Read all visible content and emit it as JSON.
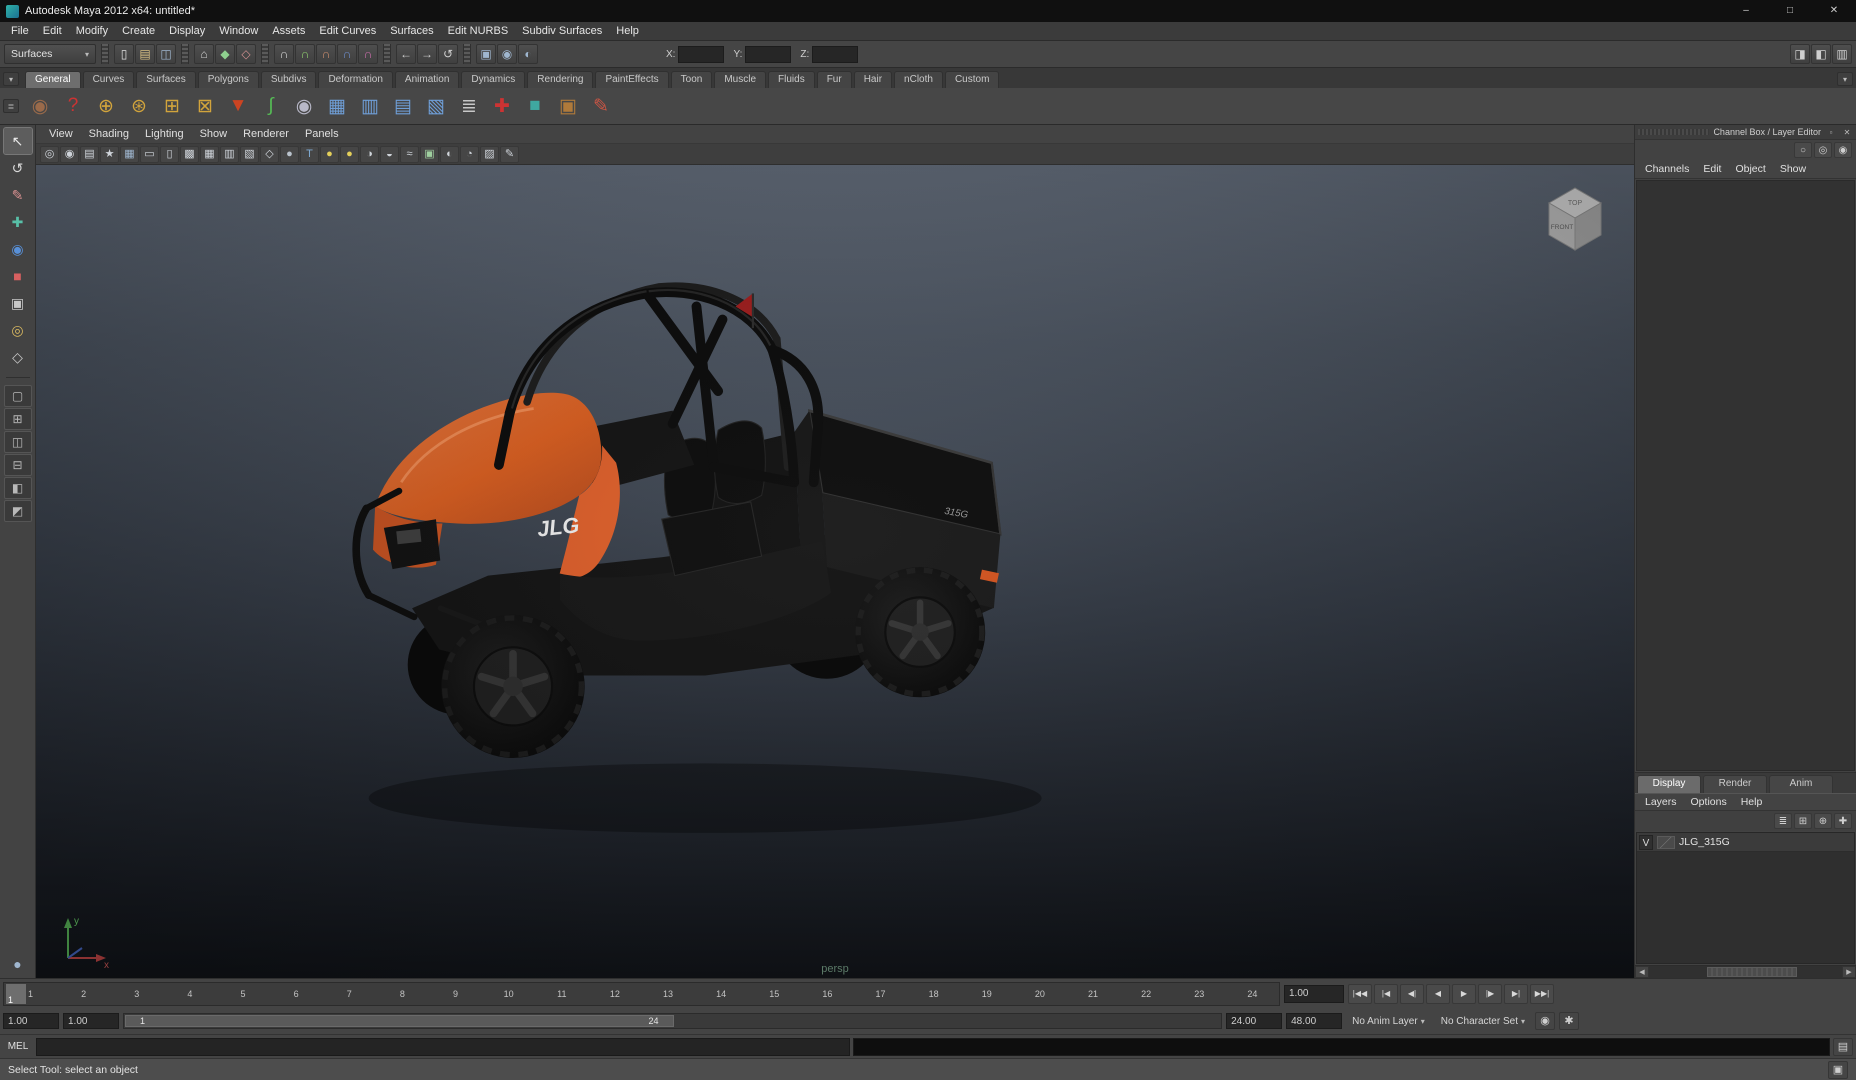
{
  "window": {
    "title": "Autodesk Maya 2012 x64: untitled*",
    "controls": [
      {
        "name": "minimize-button",
        "glyph": "–"
      },
      {
        "name": "maximize-button",
        "glyph": "□"
      },
      {
        "name": "close-button",
        "glyph": "✕"
      }
    ]
  },
  "menubar": {
    "items": [
      {
        "name": "menu-file",
        "label": "File"
      },
      {
        "name": "menu-edit",
        "label": "Edit"
      },
      {
        "name": "menu-modify",
        "label": "Modify"
      },
      {
        "name": "menu-create",
        "label": "Create"
      },
      {
        "name": "menu-display",
        "label": "Display"
      },
      {
        "name": "menu-window",
        "label": "Window"
      },
      {
        "name": "menu-assets",
        "label": "Assets"
      },
      {
        "name": "menu-edit-curves",
        "label": "Edit Curves"
      },
      {
        "name": "menu-surfaces",
        "label": "Surfaces"
      },
      {
        "name": "menu-edit-nurbs",
        "label": "Edit NURBS"
      },
      {
        "name": "menu-subdiv-surfaces",
        "label": "Subdiv Surfaces"
      },
      {
        "name": "menu-help",
        "label": "Help"
      }
    ]
  },
  "statusline": {
    "menuset": "Surfaces",
    "file_icons": [
      {
        "name": "new-scene-icon",
        "glyph": "▯",
        "color": "#e0e0e0"
      },
      {
        "name": "open-scene-icon",
        "glyph": "▤",
        "color": "#d8c084"
      },
      {
        "name": "save-scene-icon",
        "glyph": "◫",
        "color": "#9fb6cf"
      }
    ],
    "mode_icons": [
      {
        "name": "select-hierarchy-icon",
        "glyph": "⌂",
        "color": "#cfcfcf"
      },
      {
        "name": "select-object-icon",
        "glyph": "◆",
        "color": "#8fd08f"
      },
      {
        "name": "select-component-icon",
        "glyph": "◇",
        "color": "#d08f8f"
      }
    ],
    "snap_icons": [
      {
        "name": "snap-grid-icon",
        "glyph": "∩",
        "color": "#d8d8d8"
      },
      {
        "name": "snap-curve-icon",
        "glyph": "∩",
        "color": "#8fcf6f"
      },
      {
        "name": "snap-point-icon",
        "glyph": "∩",
        "color": "#cf8f6f"
      },
      {
        "name": "snap-plane-icon",
        "glyph": "∩",
        "color": "#6f8fcf"
      },
      {
        "name": "snap-surface-icon",
        "glyph": "∩",
        "color": "#cf6fae"
      }
    ],
    "history_icons": [
      {
        "name": "input-connections-icon",
        "glyph": "←",
        "color": "#cfcfcf"
      },
      {
        "name": "output-connections-icon",
        "glyph": "→",
        "color": "#cfcfcf"
      },
      {
        "name": "construction-history-icon",
        "glyph": "↺",
        "color": "#cfcfcf"
      }
    ],
    "render_icons": [
      {
        "name": "render-view-icon",
        "glyph": "▣",
        "color": "#9fb6cf"
      },
      {
        "name": "render-current-frame-icon",
        "glyph": "◉",
        "color": "#9fb6cf"
      },
      {
        "name": "ipr-render-icon",
        "glyph": "◐",
        "color": "#9fb6cf"
      }
    ],
    "x_label": "X:",
    "y_label": "Y:",
    "z_label": "Z:",
    "x_value": "",
    "y_value": "",
    "z_value": "",
    "right_toggles": [
      {
        "name": "attribute-editor-toggle",
        "glyph": "◨",
        "color": "#cfcfcf"
      },
      {
        "name": "tool-settings-toggle",
        "glyph": "◧",
        "color": "#cfcfcf"
      },
      {
        "name": "channel-box-toggle",
        "glyph": "▥",
        "color": "#cfcfcf"
      }
    ]
  },
  "shelf": {
    "tabs": [
      {
        "name": "shelf-tab-general",
        "label": "General",
        "active": true
      },
      {
        "name": "shelf-tab-curves",
        "label": "Curves"
      },
      {
        "name": "shelf-tab-surfaces",
        "label": "Surfaces"
      },
      {
        "name": "shelf-tab-polygons",
        "label": "Polygons"
      },
      {
        "name": "shelf-tab-subdivs",
        "label": "Subdivs"
      },
      {
        "name": "shelf-tab-deformation",
        "label": "Deformation"
      },
      {
        "name": "shelf-tab-animation",
        "label": "Animation"
      },
      {
        "name": "shelf-tab-dynamics",
        "label": "Dynamics"
      },
      {
        "name": "shelf-tab-rendering",
        "label": "Rendering"
      },
      {
        "name": "shelf-tab-painteffects",
        "label": "PaintEffects"
      },
      {
        "name": "shelf-tab-toon",
        "label": "Toon"
      },
      {
        "name": "shelf-tab-muscle",
        "label": "Muscle"
      },
      {
        "name": "shelf-tab-fluids",
        "label": "Fluids"
      },
      {
        "name": "shelf-tab-fur",
        "label": "Fur"
      },
      {
        "name": "shelf-tab-hair",
        "label": "Hair"
      },
      {
        "name": "shelf-tab-ncloth",
        "label": "nCloth"
      },
      {
        "name": "shelf-tab-custom",
        "label": "Custom"
      }
    ],
    "icons": [
      {
        "name": "shelf-renderglobe-icon",
        "glyph": "◉",
        "color": "#9a6a4a"
      },
      {
        "name": "shelf-help-icon",
        "glyph": "?",
        "color": "#cc3333"
      },
      {
        "name": "shelf-cluster-icon",
        "glyph": "⊕",
        "color": "#d2a43c"
      },
      {
        "name": "shelf-softmod-icon",
        "glyph": "⊛",
        "color": "#d2a43c"
      },
      {
        "name": "shelf-lattice-icon",
        "glyph": "⊞",
        "color": "#d2a43c"
      },
      {
        "name": "shelf-wrap-icon",
        "glyph": "⊠",
        "color": "#d2a43c"
      },
      {
        "name": "shelf-funnel-icon",
        "glyph": "▼",
        "color": "#cc4422"
      },
      {
        "name": "shelf-curve-icon",
        "glyph": "∫",
        "color": "#55bb55"
      },
      {
        "name": "shelf-spheres-icon",
        "glyph": "◉",
        "color": "#b8b8c8"
      },
      {
        "name": "shelf-plane-x-icon",
        "glyph": "▦",
        "color": "#6f9fd8"
      },
      {
        "name": "shelf-plane-y-icon",
        "glyph": "▥",
        "color": "#6f9fd8"
      },
      {
        "name": "shelf-plane-z-icon",
        "glyph": "▤",
        "color": "#6f9fd8"
      },
      {
        "name": "shelf-plane-free-icon",
        "glyph": "▧",
        "color": "#6f9fd8"
      },
      {
        "name": "shelf-measure-icon",
        "glyph": "≣",
        "color": "#c8c8c8"
      },
      {
        "name": "shelf-locator-icon",
        "glyph": "✚",
        "color": "#cc3333"
      },
      {
        "name": "shelf-cube-icon",
        "glyph": "■",
        "color": "#3fa8a0"
      },
      {
        "name": "shelf-crate-icon",
        "glyph": "▣",
        "color": "#b07a3a"
      },
      {
        "name": "shelf-paint-icon",
        "glyph": "✎",
        "color": "#cc5544"
      }
    ]
  },
  "toolbox": {
    "tools": [
      {
        "name": "select-tool",
        "glyph": "↖",
        "color": "#e8e8e8",
        "active": true
      },
      {
        "name": "lasso-select-tool",
        "glyph": "↺",
        "color": "#d8d8d8"
      },
      {
        "name": "paint-select-tool",
        "glyph": "✎",
        "color": "#d89090"
      },
      {
        "name": "move-tool",
        "glyph": "✚",
        "color": "#58c0a8"
      },
      {
        "name": "rotate-tool",
        "glyph": "◉",
        "color": "#5890d8"
      },
      {
        "name": "scale-tool",
        "glyph": "■",
        "color": "#d86060"
      },
      {
        "name": "universal-manipulator-tool",
        "glyph": "▣",
        "color": "#c8c8c8"
      },
      {
        "name": "soft-modification-tool",
        "glyph": "◎",
        "color": "#d8b860"
      },
      {
        "name": "last-used-tool",
        "glyph": "◇",
        "color": "#c8c8c8"
      }
    ],
    "layouts": [
      {
        "name": "layout-single-pane",
        "glyph": "▢"
      },
      {
        "name": "layout-four-pane",
        "glyph": "⊞"
      },
      {
        "name": "layout-two-pane-side",
        "glyph": "◫"
      },
      {
        "name": "layout-two-pane-stacked",
        "glyph": "⊟"
      },
      {
        "name": "layout-persp-outliner",
        "glyph": "◧"
      },
      {
        "name": "layout-hypershade-persp",
        "glyph": "◩"
      }
    ],
    "bottom_glyph": "●"
  },
  "viewport": {
    "menus": [
      {
        "name": "vp-menu-view",
        "label": "View"
      },
      {
        "name": "vp-menu-shading",
        "label": "Shading"
      },
      {
        "name": "vp-menu-lighting",
        "label": "Lighting"
      },
      {
        "name": "vp-menu-show",
        "label": "Show"
      },
      {
        "name": "vp-menu-renderer",
        "label": "Renderer"
      },
      {
        "name": "vp-menu-panels",
        "label": "Panels"
      }
    ],
    "toolbar_icons": [
      {
        "name": "select-camera-icon",
        "glyph": "◎",
        "color": "#cfd4da"
      },
      {
        "name": "lock-camera-icon",
        "glyph": "◉",
        "color": "#cfd4da"
      },
      {
        "name": "camera-attributes-icon",
        "glyph": "▤",
        "color": "#cfd4da"
      },
      {
        "name": "bookmarks-icon",
        "glyph": "★",
        "color": "#cfd4da"
      },
      {
        "name": "image-plane-icon",
        "glyph": "▦",
        "color": "#9fb6cf"
      },
      {
        "name": "film-gate-icon",
        "glyph": "▭",
        "color": "#cfd4da"
      },
      {
        "name": "resolution-gate-icon",
        "glyph": "▯",
        "color": "#cfd4da"
      },
      {
        "name": "gate-mask-icon",
        "glyph": "▩",
        "color": "#cfd4da"
      },
      {
        "name": "field-chart-icon",
        "glyph": "▦",
        "color": "#cfd4da"
      },
      {
        "name": "safe-action-icon",
        "glyph": "▥",
        "color": "#cfd4da"
      },
      {
        "name": "safe-title-icon",
        "glyph": "▧",
        "color": "#cfd4da"
      },
      {
        "name": "wireframe-icon",
        "glyph": "◇",
        "color": "#cfd4da"
      },
      {
        "name": "smooth-shade-icon",
        "glyph": "●",
        "color": "#b9c2cc"
      },
      {
        "name": "textured-icon",
        "glyph": "T",
        "color": "#7fa8d0"
      },
      {
        "name": "use-default-lighting-icon",
        "glyph": "●",
        "color": "#e3cf5a"
      },
      {
        "name": "use-all-lights-icon",
        "glyph": "●",
        "color": "#e3cf5a"
      },
      {
        "name": "shadows-icon",
        "glyph": "◑",
        "color": "#cfd4da"
      },
      {
        "name": "screen-space-ao-icon",
        "glyph": "◒",
        "color": "#cfd4da"
      },
      {
        "name": "motion-blur-icon",
        "glyph": "≈",
        "color": "#cfd4da"
      },
      {
        "name": "multisampling-icon",
        "glyph": "▣",
        "color": "#9fcf9f"
      },
      {
        "name": "depth-of-field-icon",
        "glyph": "◐",
        "color": "#cfd4da"
      },
      {
        "name": "isolate-select-icon",
        "glyph": "◔",
        "color": "#cfd4da"
      },
      {
        "name": "xray-icon",
        "glyph": "▨",
        "color": "#cfd4da"
      },
      {
        "name": "grease-pencil-icon",
        "glyph": "✎",
        "color": "#cfd4da"
      }
    ],
    "camera_label": "persp",
    "viewcube": {
      "top": "TOP",
      "front": "FRONT"
    },
    "axis": {
      "y": "y",
      "x": "x"
    },
    "model": {
      "hood_decal": "JLG",
      "bed_decal": "315G"
    }
  },
  "channelbox": {
    "header": "Channel Box / Layer Editor",
    "manip_icons": [
      {
        "name": "manip-off-icon",
        "glyph": "○"
      },
      {
        "name": "manip-hidden-icon",
        "glyph": "◎"
      },
      {
        "name": "manip-show-icon",
        "glyph": "◉"
      }
    ],
    "menus": [
      {
        "name": "cb-menu-channels",
        "label": "Channels"
      },
      {
        "name": "cb-menu-edit",
        "label": "Edit"
      },
      {
        "name": "cb-menu-object",
        "label": "Object"
      },
      {
        "name": "cb-menu-show",
        "label": "Show"
      }
    ]
  },
  "layereditor": {
    "tabs": [
      {
        "name": "le-tab-display",
        "label": "Display",
        "active": true
      },
      {
        "name": "le-tab-render",
        "label": "Render"
      },
      {
        "name": "le-tab-anim",
        "label": "Anim"
      }
    ],
    "menus": [
      {
        "name": "le-menu-layers",
        "label": "Layers"
      },
      {
        "name": "le-menu-options",
        "label": "Options"
      },
      {
        "name": "le-menu-help",
        "label": "Help"
      }
    ],
    "icons": [
      {
        "name": "layer-sort-icon",
        "glyph": "≣"
      },
      {
        "name": "new-empty-layer-icon",
        "glyph": "⊞"
      },
      {
        "name": "new-layer-assign-icon",
        "glyph": "⊕"
      },
      {
        "name": "new-layer-icon",
        "glyph": "✚"
      }
    ],
    "layers": [
      {
        "visibility": "V",
        "name": "JLG_315G"
      }
    ]
  },
  "timeslider": {
    "ticks": [
      "1",
      "2",
      "3",
      "4",
      "5",
      "6",
      "7",
      "8",
      "9",
      "10",
      "11",
      "12",
      "13",
      "14",
      "15",
      "16",
      "17",
      "18",
      "19",
      "20",
      "21",
      "22",
      "23",
      "24"
    ],
    "current_frame": "1",
    "current_time": "1.00",
    "transport": [
      {
        "name": "go-to-start-button",
        "glyph": "|◀◀"
      },
      {
        "name": "step-back-frame-button",
        "glyph": "|◀"
      },
      {
        "name": "step-back-key-button",
        "glyph": "◀|"
      },
      {
        "name": "play-backwards-button",
        "glyph": "◀"
      },
      {
        "name": "play-forwards-button",
        "glyph": "▶"
      },
      {
        "name": "step-forward-key-button",
        "glyph": "|▶"
      },
      {
        "name": "step-forward-frame-button",
        "glyph": "▶|"
      },
      {
        "name": "go-to-end-button",
        "glyph": "▶▶|"
      }
    ]
  },
  "rangeslider": {
    "anim_start": "1.00",
    "playback_start": "1.00",
    "range_start_label": "1",
    "range_end_label": "24",
    "playback_end": "24.00",
    "anim_end": "48.00",
    "anim_layer": "No Anim Layer",
    "character_set": "No Character Set"
  },
  "commandline": {
    "label": "MEL",
    "input_value": "",
    "result_value": ""
  },
  "helpline": {
    "text": "Select Tool: select an object"
  },
  "icons": {
    "caret": "▾",
    "pane_min": "▫",
    "pane_close": "✕",
    "scroll_left": "◀",
    "scroll_right": "▶",
    "autokey": "◉",
    "prefs": "✱",
    "script_editor": "▤",
    "helpline_toggle": "▣",
    "shelf_menu": "▾",
    "shelf_list": "≣"
  },
  "colors": {
    "hood_orange": "#e0601f",
    "viewport_top": "#66707f",
    "viewport_bottom": "#101318",
    "axis_y_green": "#58b558",
    "axis_x_red": "#c04545"
  }
}
